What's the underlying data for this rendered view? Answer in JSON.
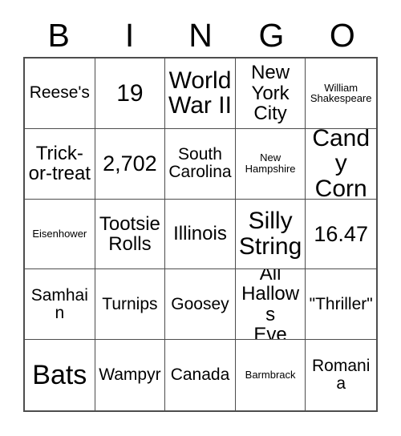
{
  "card": {
    "header_letters": [
      "B",
      "I",
      "N",
      "G",
      "O"
    ],
    "rows": [
      [
        {
          "text": "Reese's",
          "size": "fs-sm"
        },
        {
          "text": "19",
          "size": "fs-xl"
        },
        {
          "text": "World\nWar II",
          "size": "fs-xl"
        },
        {
          "text": "New\nYork\nCity",
          "size": "fs-md"
        },
        {
          "text": "William\nShakespeare",
          "size": "fs-xs"
        }
      ],
      [
        {
          "text": "Trick-\nor-treat",
          "size": "fs-md"
        },
        {
          "text": "2,702",
          "size": "fs-lg"
        },
        {
          "text": "South\nCarolina",
          "size": "fs-sm"
        },
        {
          "text": "New\nHampshire",
          "size": "fs-xs"
        },
        {
          "text": "Candy\nCorn",
          "size": "fs-xl"
        }
      ],
      [
        {
          "text": "Eisenhower",
          "size": "fs-xs"
        },
        {
          "text": "Tootsie\nRolls",
          "size": "fs-md"
        },
        {
          "text": "Illinois",
          "size": "fs-md"
        },
        {
          "text": "Silly\nString",
          "size": "fs-xl"
        },
        {
          "text": "16.47",
          "size": "fs-lg"
        }
      ],
      [
        {
          "text": "Samhain",
          "size": "fs-sm"
        },
        {
          "text": "Turnips",
          "size": "fs-sm"
        },
        {
          "text": "Goosey",
          "size": "fs-sm"
        },
        {
          "text": "All\nHallows\nEve",
          "size": "fs-md"
        },
        {
          "text": "\"Thriller\"",
          "size": "fs-sm"
        }
      ],
      [
        {
          "text": "Bats",
          "size": "fs-xxl"
        },
        {
          "text": "Wampyr",
          "size": "fs-sm"
        },
        {
          "text": "Canada",
          "size": "fs-sm"
        },
        {
          "text": "Barmbrack",
          "size": "fs-xs"
        },
        {
          "text": "Romania",
          "size": "fs-sm"
        }
      ]
    ]
  },
  "colors": {
    "background": "#ffffff",
    "text": "#000000",
    "grid_line": "#4d4d4d"
  }
}
